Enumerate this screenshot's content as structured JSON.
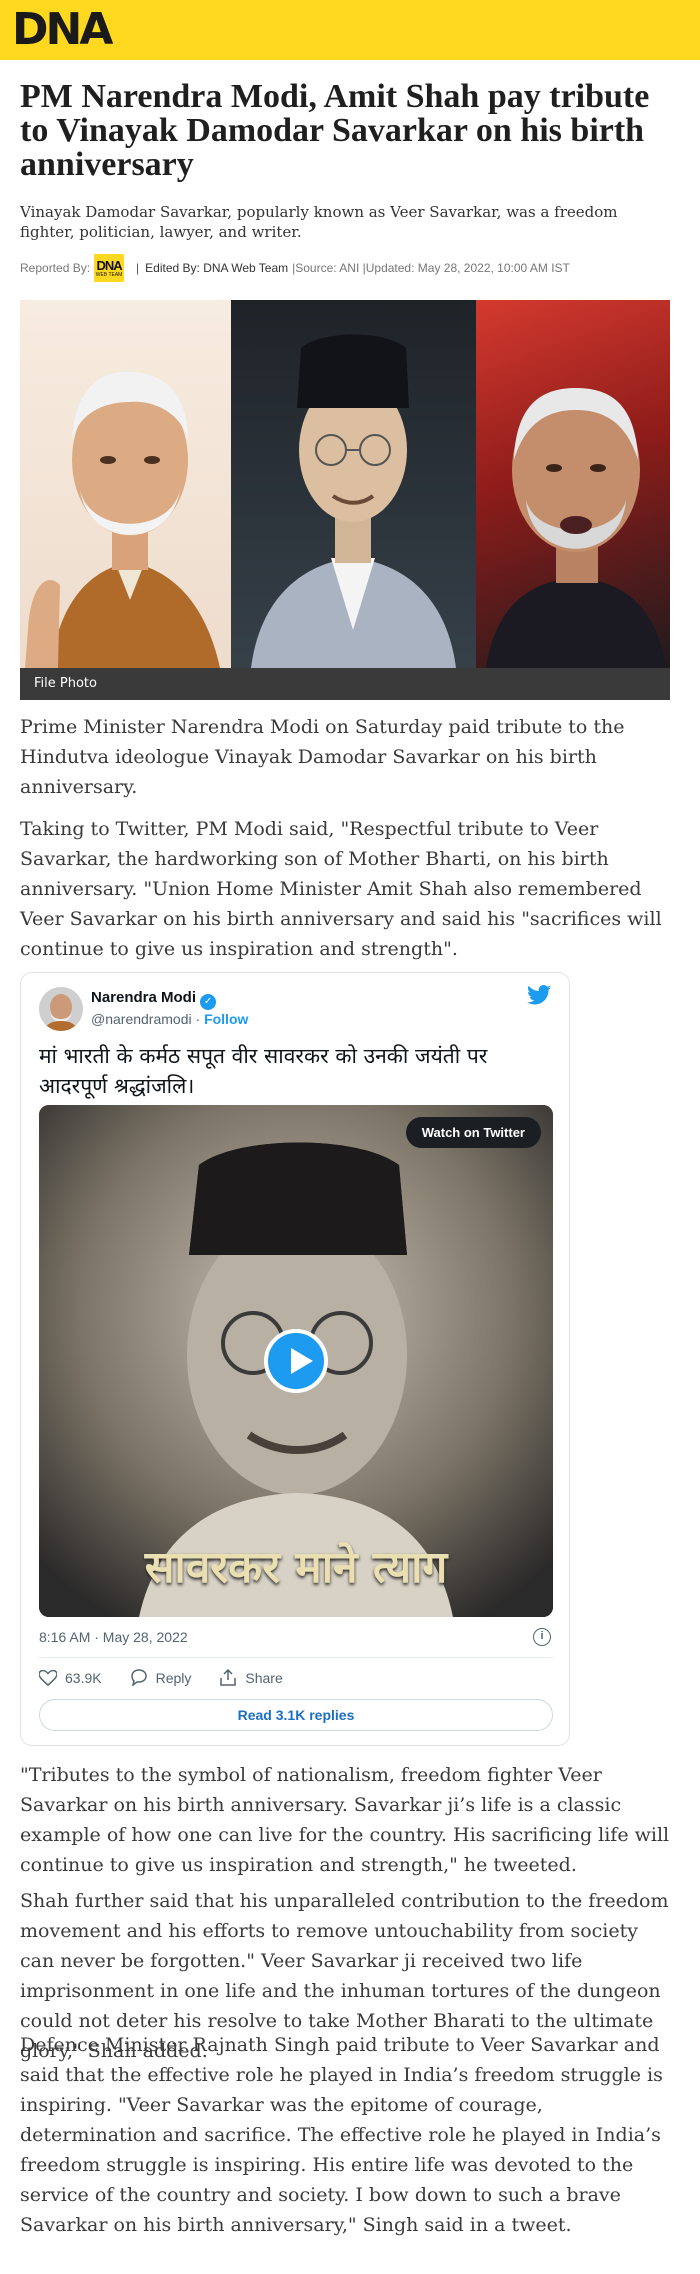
{
  "brand": {
    "logo_text": "DNA",
    "header_color": "#ffd920"
  },
  "article": {
    "headline": "PM Narendra Modi, Amit Shah pay tribute to Vinayak Damodar Savarkar on his birth anniversary",
    "summary": "Vinayak Damodar Savarkar, popularly known as Veer Savarkar, was a freedom fighter, politician, lawyer, and writer.",
    "meta": {
      "reported_by_label": "Reported By:",
      "badge_main": "DNA",
      "badge_sub": "WEB TEAM",
      "separator": "|",
      "edited_by": "Edited By: DNA Web Team",
      "source_updated": "|Source: ANI |Updated: May 28, 2022, 10:00 AM IST"
    },
    "hero_caption": "File Photo",
    "paragraphs": {
      "p1": "Prime Minister Narendra Modi on Saturday paid tribute to the Hindutva ideologue Vinayak Damodar Savarkar on his birth anniversary.",
      "p2": "Taking to Twitter, PM Modi said, \"Respectful tribute to Veer Savarkar, the hardworking son of Mother Bharti, on his birth anniversary. \"Union Home Minister Amit Shah also remembered Veer Savarkar on his birth anniversary and said his \"sacrifices will continue to give us inspiration and strength\".",
      "p3": "\"Tributes to the symbol of nationalism, freedom fighter Veer Savarkar on his birth anniversary. Savarkar ji’s life is a classic example of how one can live for the country. His sacrificing life will continue to give us inspiration and strength,\" he tweeted.",
      "p4": "Shah further said that his unparalleled contribution to the freedom movement and his efforts to remove untouchability from society can never be forgotten.\" Veer Savarkar ji received two life imprisonment in one life and the inhuman tortures of the dungeon could not deter his resolve to take Mother Bharati to the ultimate glory,\" Shah added.",
      "p5": "Defence Minister Rajnath Singh paid tribute to Veer Savarkar and said that the effective role he played in India’s freedom struggle is inspiring. \"Veer Savarkar was the epitome of courage, determination and sacrifice. The effective role he played in India’s freedom struggle is inspiring. His entire life was devoted to the service of the country and society. I bow down to such a brave Savarkar on his birth anniversary,\" Singh said in a tweet."
    }
  },
  "tweet": {
    "name": "Narendra Modi",
    "verified_icon": "verified-badge-icon",
    "handle": "@narendramodi",
    "dot": "·",
    "follow": "Follow",
    "text": "मां भारती के कर्मठ सपूत वीर सावरकर को उनकी जयंती पर आदरपूर्ण श्रद्धांजलि।",
    "watch_label": "Watch on Twitter",
    "video_overlay": "सावरकर माने त्याग",
    "timestamp": "8:16 AM · May 28, 2022",
    "likes": "63.9K",
    "reply_label": "Reply",
    "share_label": "Share",
    "read_replies": "Read 3.1K replies",
    "colors": {
      "twitter_blue": "#1d9bf0",
      "link_blue": "#1d6fc1"
    }
  }
}
